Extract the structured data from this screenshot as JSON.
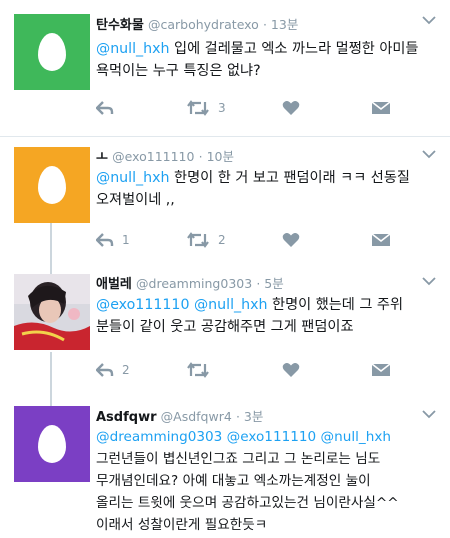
{
  "tweets": [
    {
      "name": "탄수화물",
      "handle": "@carbohydratexo",
      "time": "13분",
      "mention": "@null_hxh",
      "lines": [
        "입에 걸레물고 엑소 까느라 멀쩡한 아미들",
        "욕먹이는 누구 특징은 없냐?"
      ],
      "reply_count": "",
      "retweet_count": "3",
      "avatar_color": "#3fb85a"
    },
    {
      "name": "ㅗ",
      "handle": "@exo111110",
      "time": "10분",
      "mention": "@null_hxh",
      "lines": [
        "한명이 한 거 보고 팬덤이래 ㅋㅋ 선동질",
        "오져벌이네 ,,"
      ],
      "reply_count": "1",
      "retweet_count": "2",
      "avatar_color": "#f5a623"
    },
    {
      "name": "애벌레",
      "handle": "@dreamming0303",
      "time": "5분",
      "mentions": [
        "@exo111110",
        "@null_hxh"
      ],
      "lines": [
        "한명이 했는데 그 주위",
        "분들이 같이 웃고 공감해주면 그게 팬덤이죠"
      ],
      "reply_count": "2",
      "retweet_count": ""
    },
    {
      "name": "Asdfqwr",
      "handle": "@Asdfqwr4",
      "time": "3분",
      "mentions": [
        "@dreamming0303",
        "@exo111110",
        "@null_hxh"
      ],
      "lines": [
        "그런년들이 볍신년인그죠 그리고 그 논리로는 님도",
        "무개념인데요? 아예 대놓고 엑소까는계정인 눌이",
        "올리는 트윗에 웃으며 공감하고있는건 님이란사실^^",
        "이래서 성찰이란게 필요한듯ㅋ"
      ],
      "avatar_color": "#7b3fc4"
    }
  ],
  "icons": [
    "reply-icon",
    "retweet-icon",
    "like-icon",
    "message-icon",
    "chevron-down-icon"
  ]
}
